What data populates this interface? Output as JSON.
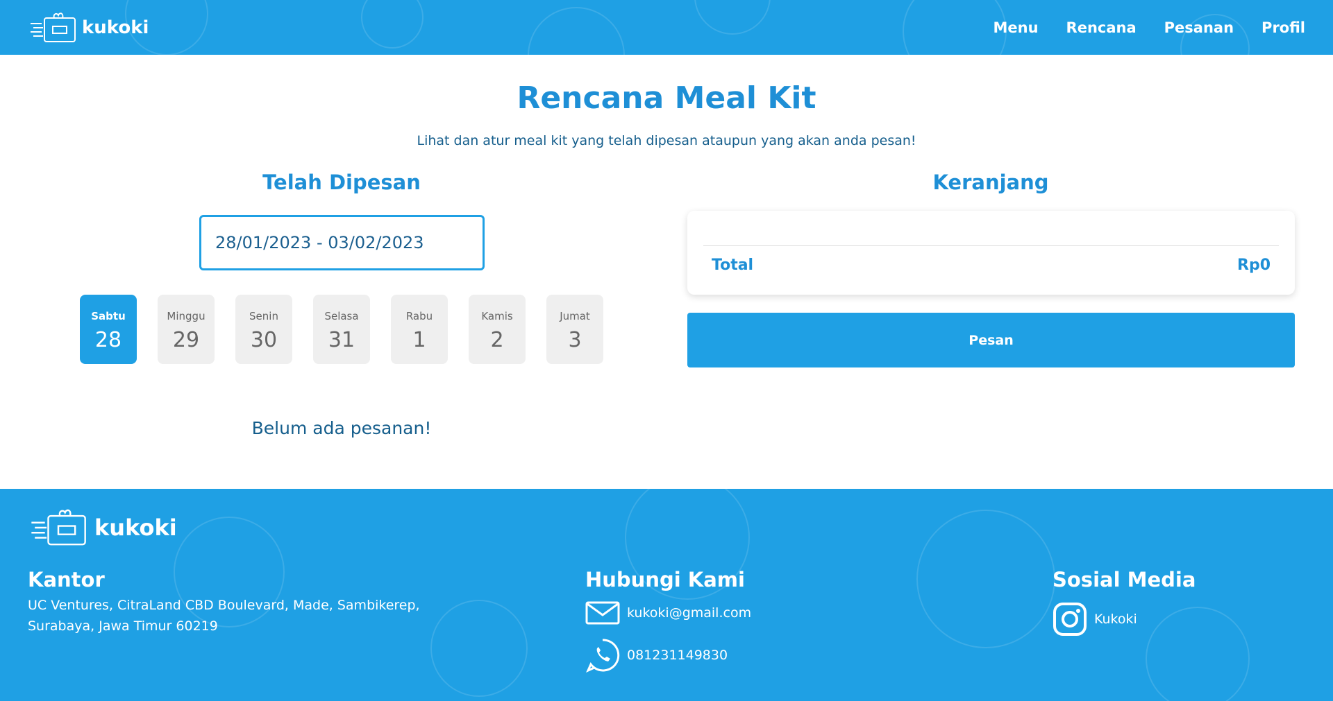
{
  "header": {
    "brand": "kukoki",
    "nav": [
      "Menu",
      "Rencana",
      "Pesanan",
      "Profil"
    ]
  },
  "page": {
    "title": "Rencana Meal Kit",
    "subtitle": "Lihat dan atur meal kit yang telah dipesan ataupun yang akan anda pesan!"
  },
  "ordered": {
    "title": "Telah Dipesan",
    "date_range": "28/01/2023 - 03/02/2023",
    "days": [
      {
        "name": "Sabtu",
        "num": "28",
        "active": true
      },
      {
        "name": "Minggu",
        "num": "29",
        "active": false
      },
      {
        "name": "Senin",
        "num": "30",
        "active": false
      },
      {
        "name": "Selasa",
        "num": "31",
        "active": false
      },
      {
        "name": "Rabu",
        "num": "1",
        "active": false
      },
      {
        "name": "Kamis",
        "num": "2",
        "active": false
      },
      {
        "name": "Jumat",
        "num": "3",
        "active": false
      }
    ],
    "empty_message": "Belum ada pesanan!"
  },
  "cart": {
    "title": "Keranjang",
    "total_label": "Total",
    "total_value": "Rp0",
    "order_button": "Pesan"
  },
  "footer": {
    "brand": "kukoki",
    "office": {
      "heading": "Kantor",
      "line1": "UC Ventures, CitraLand CBD Boulevard, Made, Sambikerep,",
      "line2": "Surabaya, Jawa Timur 60219"
    },
    "contact": {
      "heading": "Hubungi Kami",
      "email": "kukoki@gmail.com",
      "phone": "081231149830"
    },
    "social": {
      "heading": "Sosial Media",
      "instagram": "Kukoki"
    }
  },
  "colors": {
    "primary": "#1fa0e4",
    "title": "#1e8fd6",
    "text_dark": "#155e8c",
    "day_inactive": "#efefef"
  }
}
